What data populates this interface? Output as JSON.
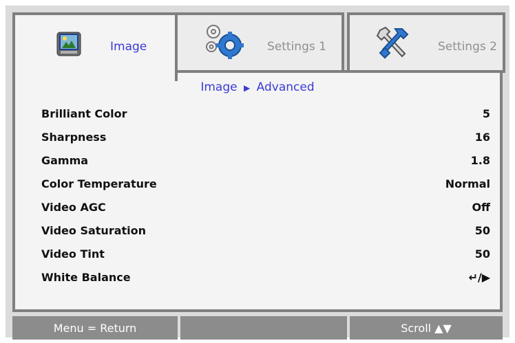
{
  "tabs": [
    {
      "label": "Image",
      "icon": "image-icon",
      "active": true
    },
    {
      "label": "Settings 1",
      "icon": "gears-icon",
      "active": false
    },
    {
      "label": "Settings 2",
      "icon": "tools-icon",
      "active": false
    }
  ],
  "breadcrumb": {
    "parent": "Image",
    "separator": "▶",
    "child": "Advanced"
  },
  "menu_items": [
    {
      "label": "Brilliant Color",
      "value": "5"
    },
    {
      "label": "Sharpness",
      "value": "16"
    },
    {
      "label": "Gamma",
      "value": "1.8"
    },
    {
      "label": "Color Temperature",
      "value": "Normal"
    },
    {
      "label": "Video AGC",
      "value": "Off"
    },
    {
      "label": "Video Saturation",
      "value": "50"
    },
    {
      "label": "Video Tint",
      "value": "50"
    },
    {
      "label": "White Balance",
      "value": "↵/▶"
    }
  ],
  "footer": {
    "left": "Menu = Return",
    "middle": "",
    "right": "Scroll ▲▼"
  },
  "colors": {
    "accent": "#3b3bd6",
    "frame": "#7f7f7f",
    "bar": "#8c8c8c",
    "panel": "#f4f4f4"
  }
}
